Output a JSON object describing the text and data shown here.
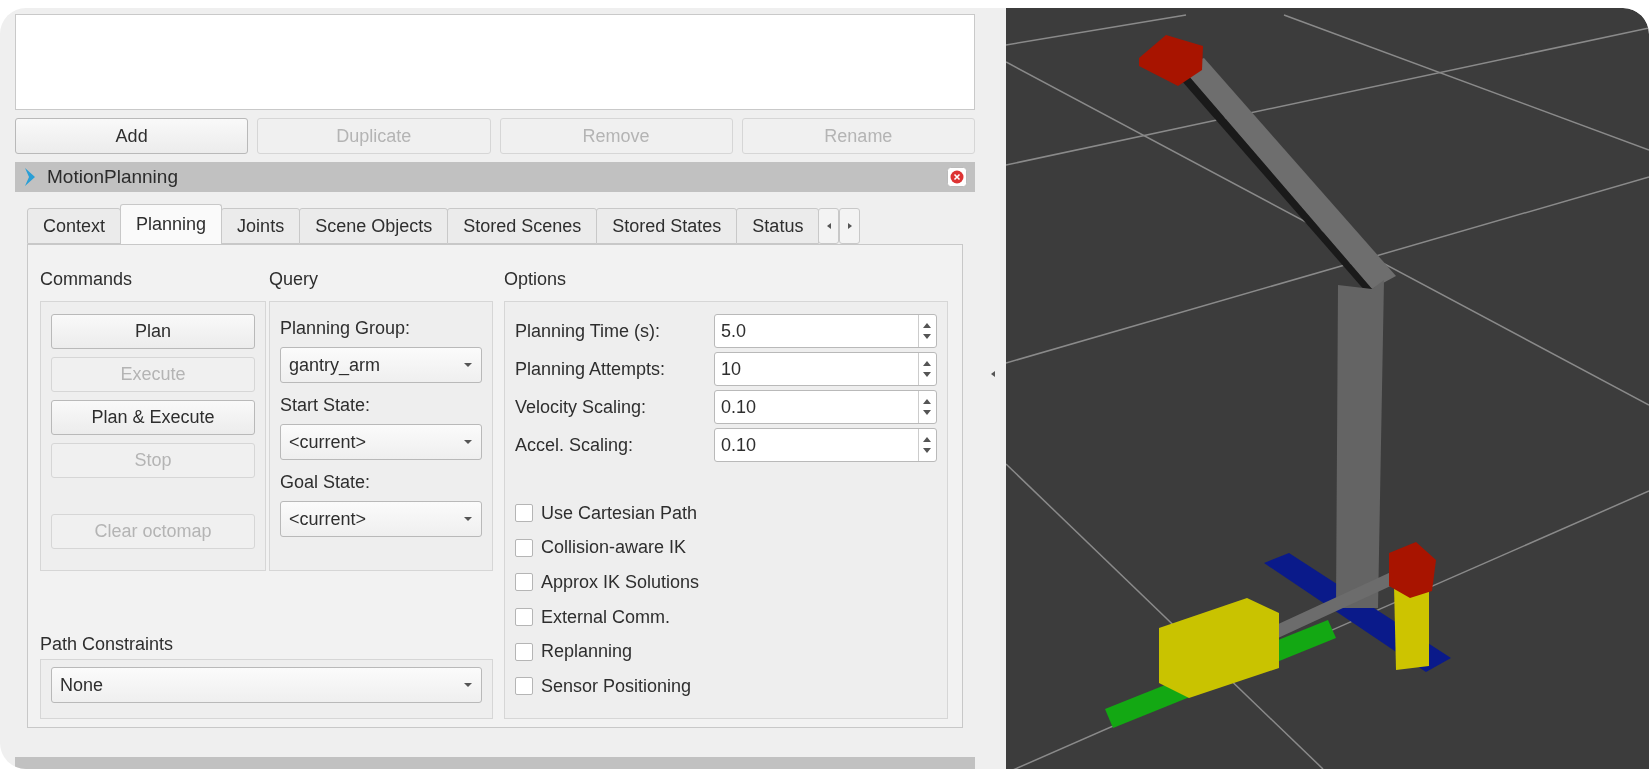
{
  "display_buttons": [
    {
      "label": "Add",
      "disabled": false
    },
    {
      "label": "Duplicate",
      "disabled": true
    },
    {
      "label": "Remove",
      "disabled": true
    },
    {
      "label": "Rename",
      "disabled": true
    }
  ],
  "panel": {
    "title": "MotionPlanning",
    "tabs": [
      {
        "label": "Context",
        "selected": false
      },
      {
        "label": "Planning",
        "selected": true
      },
      {
        "label": "Joints",
        "selected": false
      },
      {
        "label": "Scene Objects",
        "selected": false
      },
      {
        "label": "Stored Scenes",
        "selected": false
      },
      {
        "label": "Stored States",
        "selected": false
      },
      {
        "label": "Status",
        "selected": false
      }
    ],
    "commands": {
      "title": "Commands",
      "buttons": [
        {
          "label": "Plan",
          "disabled": false
        },
        {
          "label": "Execute",
          "disabled": true
        },
        {
          "label": "Plan & Execute",
          "disabled": false
        },
        {
          "label": "Stop",
          "disabled": true
        },
        {
          "label": "Clear octomap",
          "disabled": true
        }
      ]
    },
    "query": {
      "title": "Query",
      "fields": [
        {
          "label": "Planning Group:",
          "value": "gantry_arm"
        },
        {
          "label": "Start State:",
          "value": "<current>"
        },
        {
          "label": "Goal State:",
          "value": "<current>"
        }
      ]
    },
    "options": {
      "title": "Options",
      "spinners": [
        {
          "label": "Planning Time (s):",
          "value": "5.0"
        },
        {
          "label": "Planning Attempts:",
          "value": "10"
        },
        {
          "label": "Velocity Scaling:",
          "value": "0.10"
        },
        {
          "label": "Accel. Scaling:",
          "value": "0.10"
        }
      ],
      "checkboxes": [
        {
          "label": "Use Cartesian Path",
          "checked": false
        },
        {
          "label": "Collision-aware IK",
          "checked": false
        },
        {
          "label": "Approx IK Solutions",
          "checked": false
        },
        {
          "label": "External Comm.",
          "checked": false
        },
        {
          "label": "Replanning",
          "checked": false
        },
        {
          "label": "Sensor Positioning",
          "checked": false
        }
      ]
    },
    "path_constraints": {
      "title": "Path Constraints",
      "value": "None"
    }
  }
}
